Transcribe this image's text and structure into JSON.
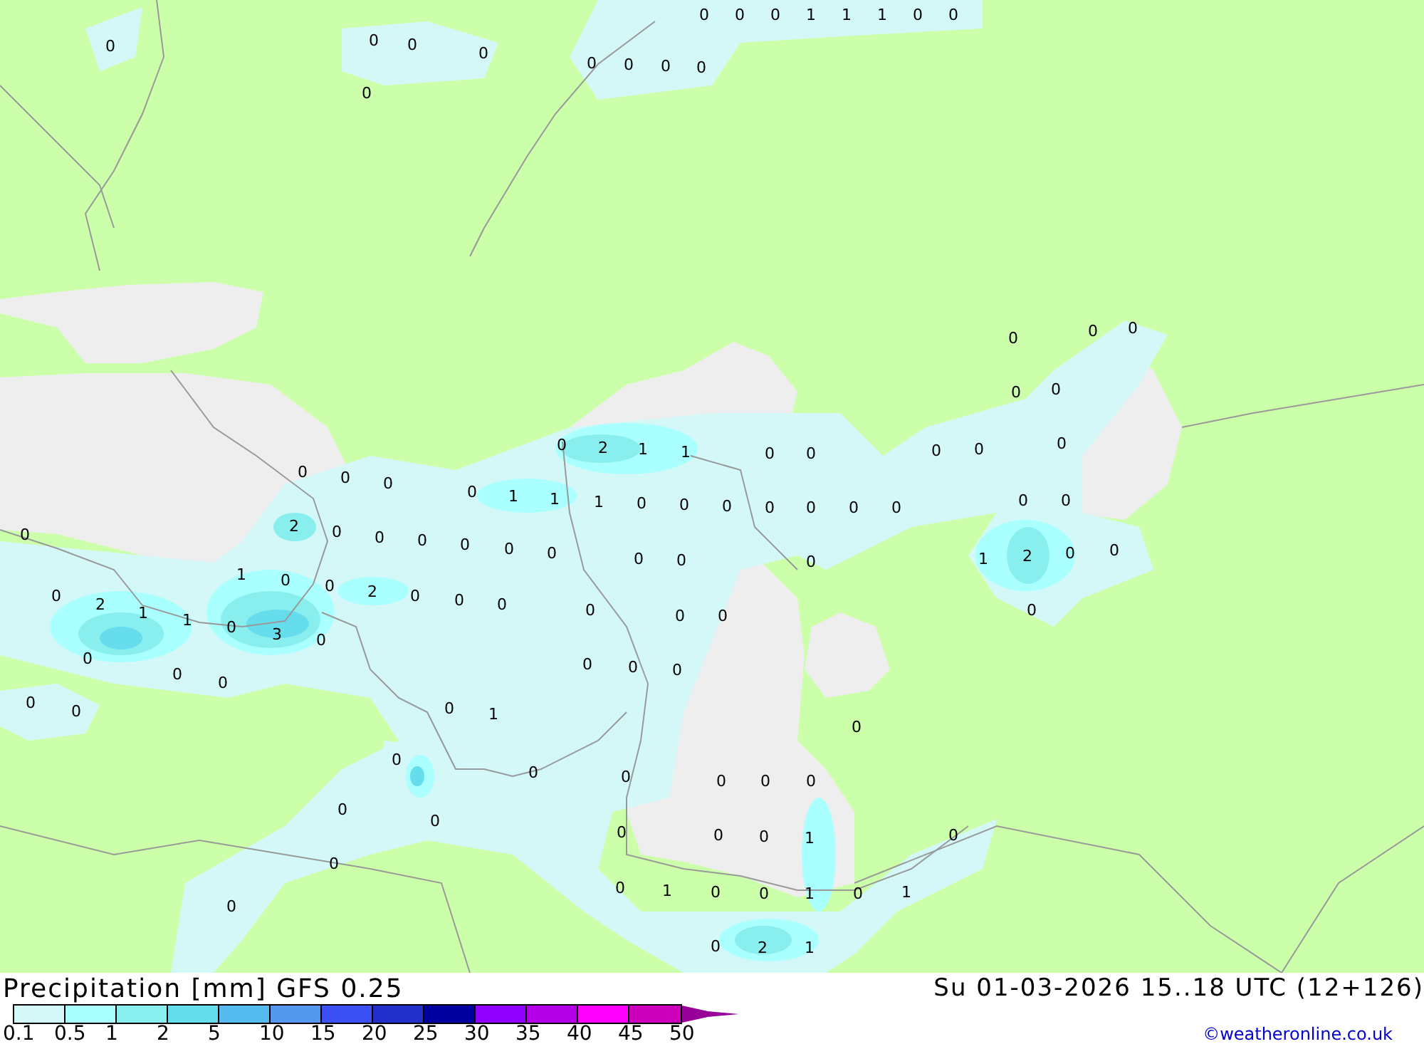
{
  "map": {
    "value_labels": [
      "0",
      "0",
      "0",
      "1",
      "1",
      "1",
      "0",
      "0",
      "0",
      "0",
      "0",
      "0",
      "0",
      "0",
      "0",
      "0",
      "0",
      "0",
      "0",
      "0",
      "0",
      "0",
      "0",
      "2",
      "1",
      "1",
      "0",
      "0",
      "0",
      "0",
      "0",
      "0",
      "0",
      "0",
      "0",
      "1",
      "1",
      "1",
      "0",
      "0",
      "0",
      "0",
      "0",
      "0",
      "0",
      "0",
      "0",
      "0",
      "2",
      "0",
      "0",
      "0",
      "0",
      "0",
      "0",
      "0",
      "0",
      "0",
      "1",
      "2",
      "0",
      "0",
      "1",
      "0",
      "0",
      "2",
      "0",
      "0",
      "0",
      "0",
      "2",
      "1",
      "1",
      "0",
      "3",
      "0",
      "0",
      "0",
      "0",
      "0",
      "0",
      "0",
      "0",
      "0",
      "0",
      "0",
      "0",
      "0",
      "0",
      "1",
      "0",
      "0",
      "0",
      "0",
      "0",
      "0",
      "0",
      "0",
      "0",
      "0",
      "0",
      "0",
      "1",
      "0",
      "0",
      "0",
      "1",
      "0",
      "0",
      "1",
      "0",
      "1",
      "0",
      "0",
      "2",
      "1"
    ]
  },
  "title": "Precipitation [mm] GFS 0.25",
  "valid_time": "Su 01-03-2026 15..18 UTC (12+126)",
  "legend": {
    "bins": [
      {
        "color": "#d4f8f8"
      },
      {
        "color": "#aaffff"
      },
      {
        "color": "#88eeee"
      },
      {
        "color": "#66dded"
      },
      {
        "color": "#55bbee"
      },
      {
        "color": "#5599ee"
      },
      {
        "color": "#3c50f5"
      },
      {
        "color": "#2030c8"
      },
      {
        "color": "#0000a0"
      },
      {
        "color": "#9000ff"
      },
      {
        "color": "#b400e8"
      },
      {
        "color": "#ff00ff"
      },
      {
        "color": "#cc00bb"
      }
    ],
    "ticks": [
      "0.1",
      "0.5",
      "1",
      "2",
      "5",
      "10",
      "15",
      "20",
      "25",
      "30",
      "35",
      "40",
      "45",
      "50"
    ]
  },
  "credit": "©weatheronline.co.uk"
}
